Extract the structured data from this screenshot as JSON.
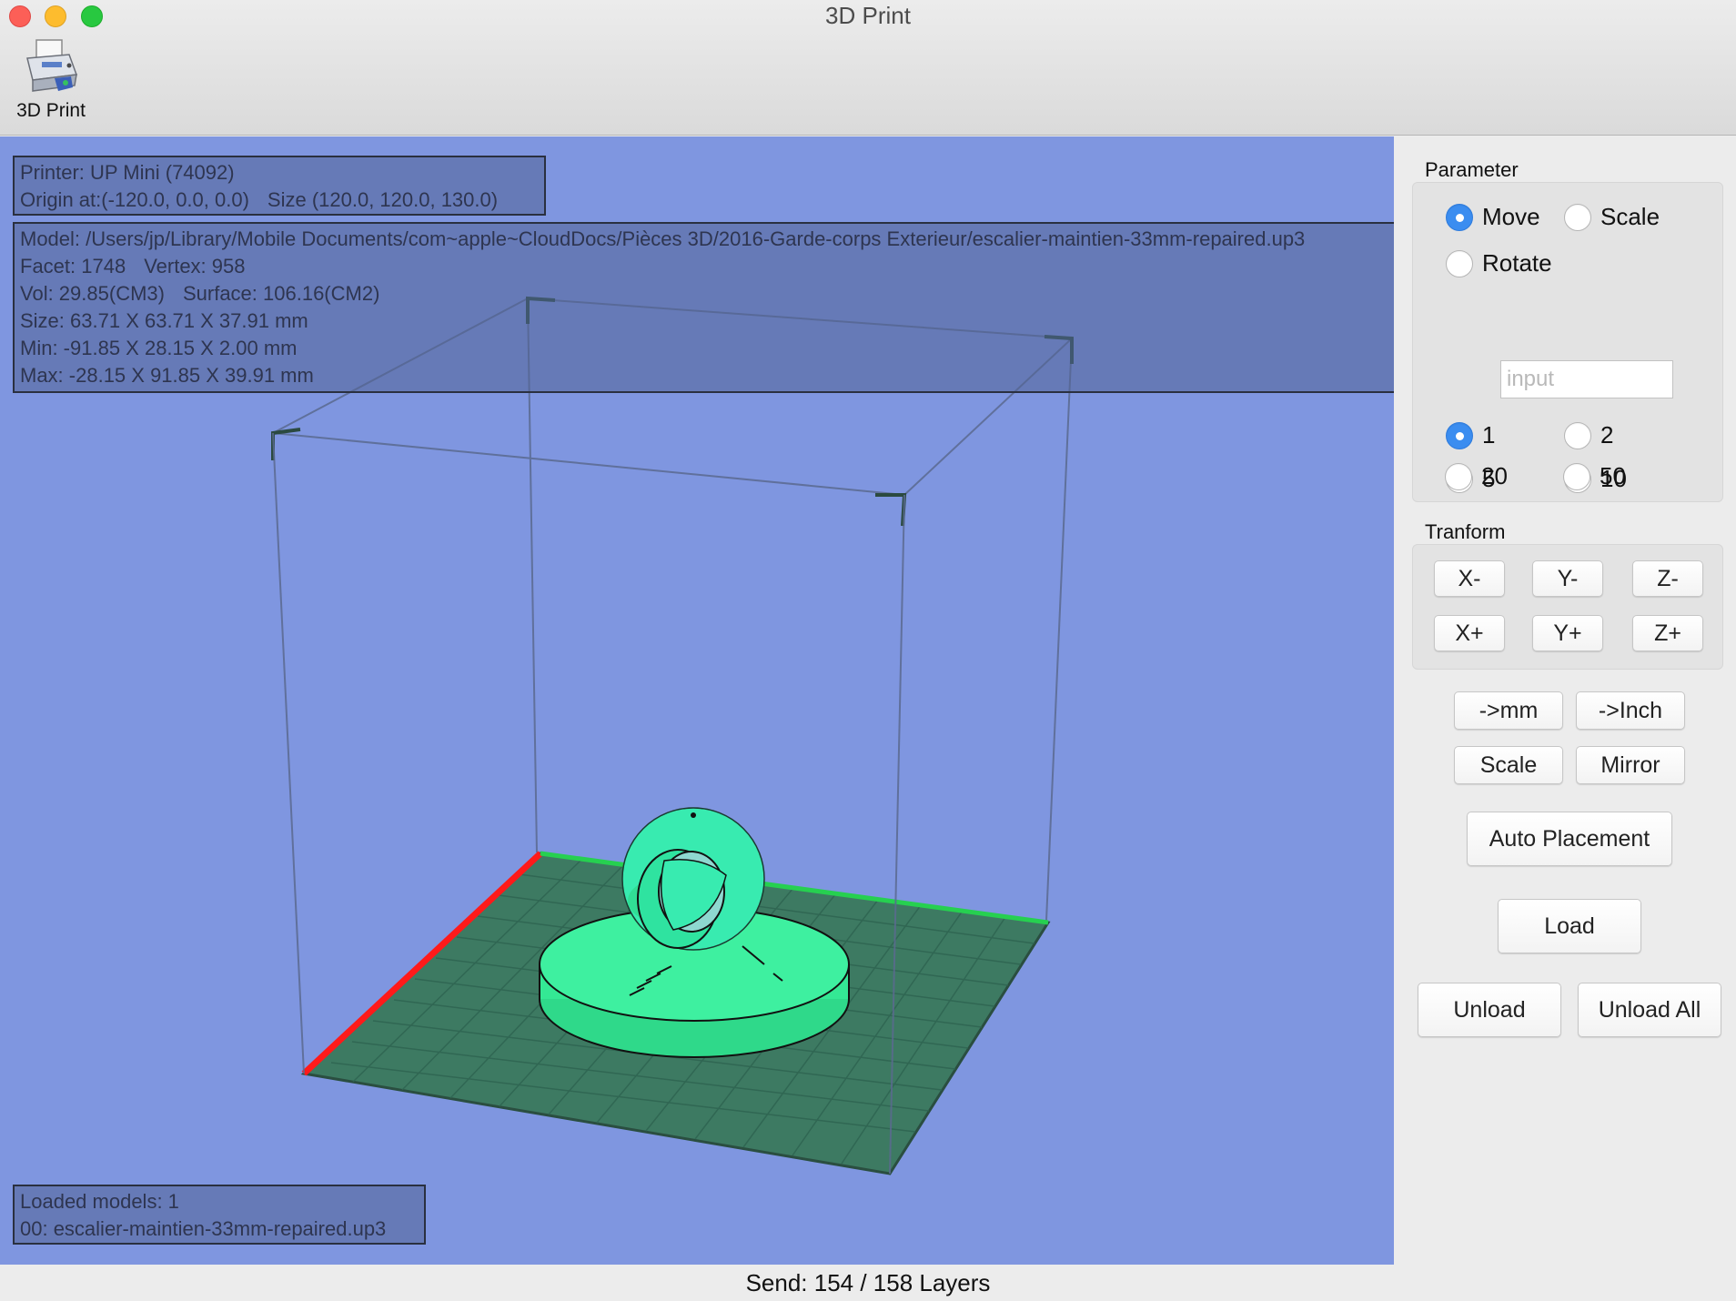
{
  "window": {
    "title": "3D Print"
  },
  "toolbar": {
    "print_label": "3D Print"
  },
  "overlay": {
    "printer": "Printer: UP Mini (74092)",
    "origin": "Origin at:(-120.0, 0.0, 0.0)",
    "size": "Size (120.0, 120.0, 130.0)",
    "model": "Model: /Users/jp/Library/Mobile Documents/com~apple~CloudDocs/Pièces 3D/2016-Garde-corps Exterieur/escalier-maintien-33mm-repaired.up3",
    "facet": "Facet: 1748",
    "vertex": "Vertex: 958",
    "vol": "Vol: 29.85(CM3)",
    "surface": "Surface: 106.16(CM2)",
    "model_size": "Size:  63.71 X  63.71 X  37.91 mm",
    "min": "Min: -91.85 X  28.15 X   2.00 mm",
    "max": "Max: -28.15 X  91.85 X  39.91 mm",
    "loaded_count": "Loaded models: 1",
    "loaded_item": "00: escalier-maintien-33mm-repaired.up3"
  },
  "status": {
    "text": "Send: 154 / 158 Layers"
  },
  "panel": {
    "parameter_title": "Parameter",
    "mode_move": "Move",
    "mode_scale": "Scale",
    "mode_rotate": "Rotate",
    "selected_mode": "Move",
    "input_placeholder": "input",
    "steps": [
      "1",
      "2",
      "5",
      "10",
      "20",
      "50"
    ],
    "selected_step": "1",
    "transform_title": "Tranform",
    "x_minus": "X-",
    "y_minus": "Y-",
    "z_minus": "Z-",
    "x_plus": "X+",
    "y_plus": "Y+",
    "z_plus": "Z+",
    "to_mm": "->mm",
    "to_inch": "->Inch",
    "scale": "Scale",
    "mirror": "Mirror",
    "auto_placement": "Auto Placement",
    "load": "Load",
    "unload": "Unload",
    "unload_all": "Unload All"
  },
  "colors": {
    "viewport_bg": "#7f96e0",
    "platform": "#3d7a62",
    "model": "#3ef0a0",
    "x_axis": "#ff1a1a",
    "radio_selected": "#3b8df0"
  }
}
